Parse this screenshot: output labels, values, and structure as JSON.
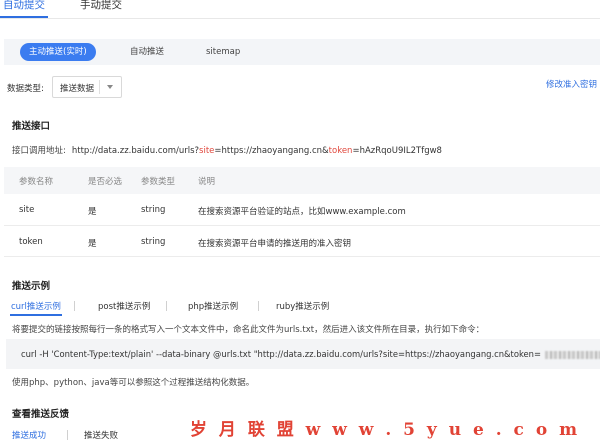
{
  "top_tabs": [
    {
      "label": "自动提交",
      "active": true
    },
    {
      "label": "手动提交",
      "active": false
    }
  ],
  "sub_tabs": [
    {
      "label": "主动推送(实时)",
      "active": true
    },
    {
      "label": "自动推送",
      "active": false
    },
    {
      "label": "sitemap",
      "active": false
    }
  ],
  "data_type": {
    "label": "数据类型:",
    "selected": "推送数据",
    "caret_icon": "chevron-down-icon"
  },
  "edit_link": "修改准入密钥",
  "push_api": {
    "title": "推送接口",
    "url_label": "接口调用地址:",
    "url_prefix": "http://data.zz.baidu.com/urls?",
    "param_site": "site",
    "url_mid": "=https://zhaoyangang.cn&",
    "param_token": "token",
    "url_suffix": "=hAzRqoU9IL2Tfgw8"
  },
  "param_table": {
    "headers": [
      "参数名称",
      "是否必选",
      "参数类型",
      "说明"
    ],
    "rows": [
      [
        "site",
        "是",
        "string",
        "在搜索资源平台验证的站点，比如www.example.com"
      ],
      [
        "token",
        "是",
        "string",
        "在搜索资源平台申请的推送用的准入密钥"
      ]
    ]
  },
  "examples": {
    "title": "推送示例",
    "tabs": [
      {
        "label": "curl推送示例",
        "active": true
      },
      {
        "label": "post推送示例",
        "active": false
      },
      {
        "label": "php推送示例",
        "active": false
      },
      {
        "label": "ruby推送示例",
        "active": false
      }
    ],
    "description": "将要提交的链接按照每行一条的格式写入一个文本文件中，命名此文件为urls.txt，然后进入该文件所在目录，执行如下命令：",
    "command": "curl -H 'Content-Type:text/plain' --data-binary @urls.txt \"http://data.zz.baidu.com/urls?site=https://zhaoyangang.cn&token=",
    "note": "使用php、python、java等可以参照这个过程推送结构化数据。"
  },
  "feedback": {
    "title": "查看推送反馈",
    "tabs": [
      {
        "label": "推送成功",
        "active": true
      },
      {
        "label": "推送失败",
        "active": false
      }
    ]
  },
  "watermark": "岁 月 联 盟   w w w . 5 y u e . c o m",
  "colors": {
    "accent": "#2f6fe0",
    "active_pill": "#3b7cf0",
    "param_highlight": "#e0473c",
    "watermark": "#e0392b"
  }
}
